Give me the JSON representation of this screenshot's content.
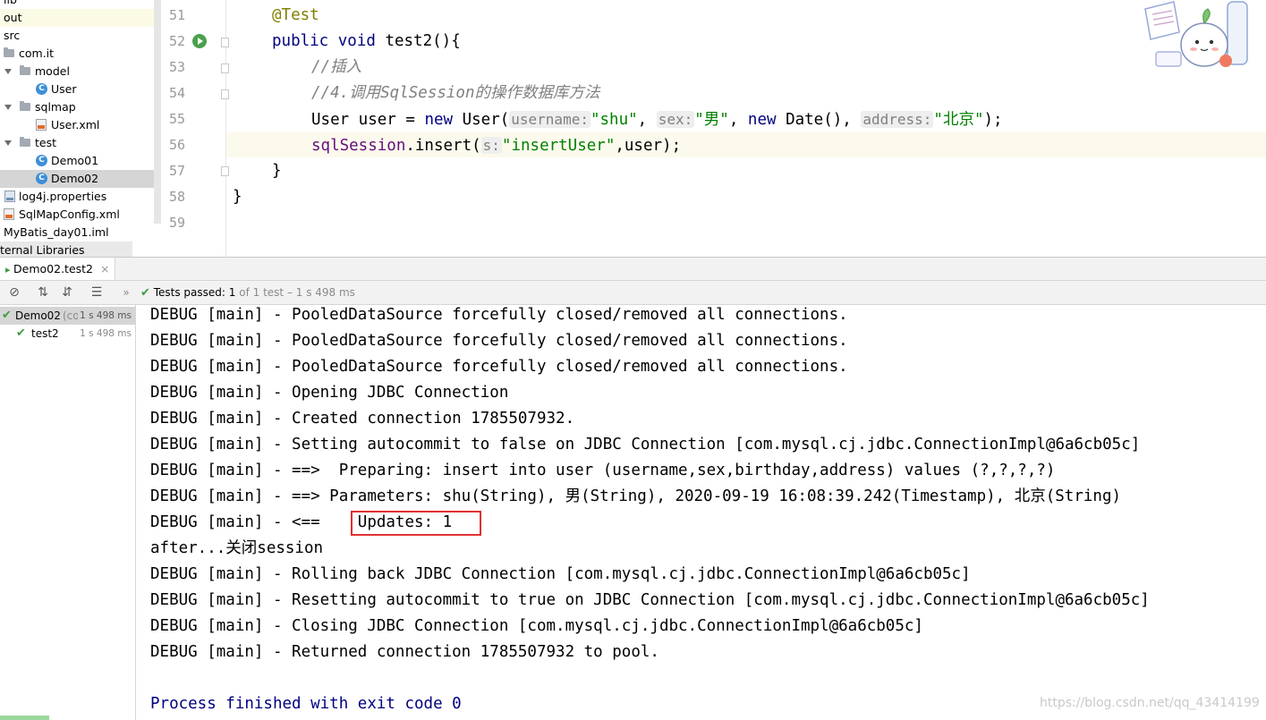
{
  "project_tree": {
    "items": [
      {
        "label": "lib"
      },
      {
        "label": "out"
      },
      {
        "label": "src"
      },
      {
        "label": "com.it"
      },
      {
        "label": "model"
      },
      {
        "label": "User"
      },
      {
        "label": "sqlmap"
      },
      {
        "label": "User.xml"
      },
      {
        "label": "test"
      },
      {
        "label": "Demo01"
      },
      {
        "label": "Demo02"
      },
      {
        "label": "log4j.properties"
      },
      {
        "label": "SqlMapConfig.xml"
      },
      {
        "label": "MyBatis_day01.iml"
      },
      {
        "label": "ternal Libraries"
      }
    ]
  },
  "editor": {
    "line_numbers": [
      "51",
      "52",
      "53",
      "54",
      "55",
      "56",
      "57",
      "58",
      "59"
    ],
    "code": {
      "l51": "@Test",
      "l52_kw": "public void",
      "l52_rest": " test2(){",
      "l53": "//插入",
      "l54": "//4.调用SqlSession的操作数据库方法",
      "l55_a": "User user = ",
      "l55_new": "new",
      "l55_b": " User(",
      "l55_hint1": "username:",
      "l55_s1": "\"shu\"",
      "l55_c1": ", ",
      "l55_hint2": "sex:",
      "l55_s2": "\"男\"",
      "l55_c2": ", ",
      "l55_new2": "new",
      "l55_d": " Date(), ",
      "l55_hint3": "address:",
      "l55_s3": "\"北京\"",
      "l55_e": ");",
      "l56_field": "sqlSession",
      "l56_a": ".insert(",
      "l56_hint": "s:",
      "l56_s": "\"insertUser\"",
      "l56_b": ",user);",
      "l57": "}",
      "l58": "}"
    }
  },
  "run_window": {
    "tab_label": "Demo02.test2",
    "tab_close": "×",
    "status": {
      "label": "Tests passed:",
      "count": "1",
      "rest": "of 1 test – 1 s 498 ms"
    },
    "test_tree": [
      {
        "label": "Demo02",
        "sub": "(cor",
        "duration": "1 s 498 ms"
      },
      {
        "label": "test2",
        "duration": "1 s 498 ms"
      }
    ],
    "console_lines": [
      "DEBUG [main] - PooledDataSource forcefully closed/removed all connections.",
      "DEBUG [main] - PooledDataSource forcefully closed/removed all connections.",
      "DEBUG [main] - PooledDataSource forcefully closed/removed all connections.",
      "DEBUG [main] - Opening JDBC Connection",
      "DEBUG [main] - Created connection 1785507932.",
      "DEBUG [main] - Setting autocommit to false on JDBC Connection [com.mysql.cj.jdbc.ConnectionImpl@6a6cb05c]",
      "DEBUG [main] - ==>  Preparing: insert into user (username,sex,birthday,address) values (?,?,?,?)",
      "DEBUG [main] - ==> Parameters: shu(String), 男(String), 2020-09-19 16:08:39.242(Timestamp), 北京(String)",
      "DEBUG [main] - <==    Updates: 1",
      "after...关闭session",
      "DEBUG [main] - Rolling back JDBC Connection [com.mysql.cj.jdbc.ConnectionImpl@6a6cb05c]",
      "DEBUG [main] - Resetting autocommit to true on JDBC Connection [com.mysql.cj.jdbc.ConnectionImpl@6a6cb05c]",
      "DEBUG [main] - Closing JDBC Connection [com.mysql.cj.jdbc.ConnectionImpl@6a6cb05c]",
      "DEBUG [main] - Returned connection 1785507932 to pool."
    ],
    "exit_line": "Process finished with exit code 0"
  },
  "watermark": "https://blog.csdn.net/qq_43414199",
  "colors": {
    "keyword": "#000080",
    "string": "#008000",
    "annotation": "#808000",
    "comment": "#808080",
    "field": "#660e7a",
    "highlight_box": "#e03131",
    "pass_green": "#3f9b3f"
  }
}
